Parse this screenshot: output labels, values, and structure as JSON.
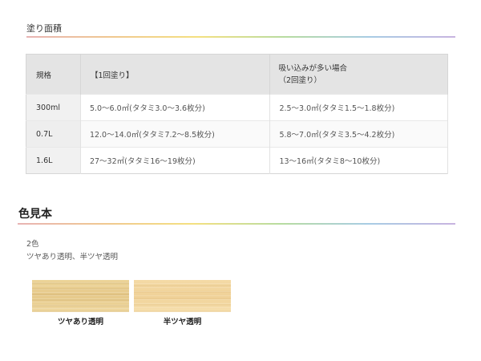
{
  "coverage": {
    "title": "塗り面積",
    "headers": {
      "spec": "規格",
      "one_coat": "【1回塗り】",
      "absorbent_line1": "吸い込みが多い場合",
      "absorbent_line2": "（2回塗り）"
    },
    "rows": [
      {
        "spec": "300ml",
        "one_coat": "5.0〜6.0㎡(タタミ3.0〜3.6枚分)",
        "absorbent": "2.5〜3.0㎡(タタミ1.5〜1.8枚分)"
      },
      {
        "spec": "0.7L",
        "one_coat": "12.0〜14.0㎡(タタミ7.2〜8.5枚分)",
        "absorbent": "5.8〜7.0㎡(タタミ3.5〜4.2枚分)"
      },
      {
        "spec": "1.6L",
        "one_coat": "27〜32㎡(タタミ16〜19枚分)",
        "absorbent": "13〜16㎡(タタミ8〜10枚分)"
      }
    ]
  },
  "swatches_section": {
    "title": "色見本",
    "count_text": "2色",
    "names_text": "ツヤあり透明、半ツヤ透明",
    "swatches": [
      {
        "label": "ツヤあり透明",
        "color": "#e9cf92"
      },
      {
        "label": "半ツヤ透明",
        "color": "#f2d6a0"
      }
    ]
  },
  "colors": {
    "header_bg": "#e4e4e4",
    "spec_bg": "#f1f1f1"
  }
}
